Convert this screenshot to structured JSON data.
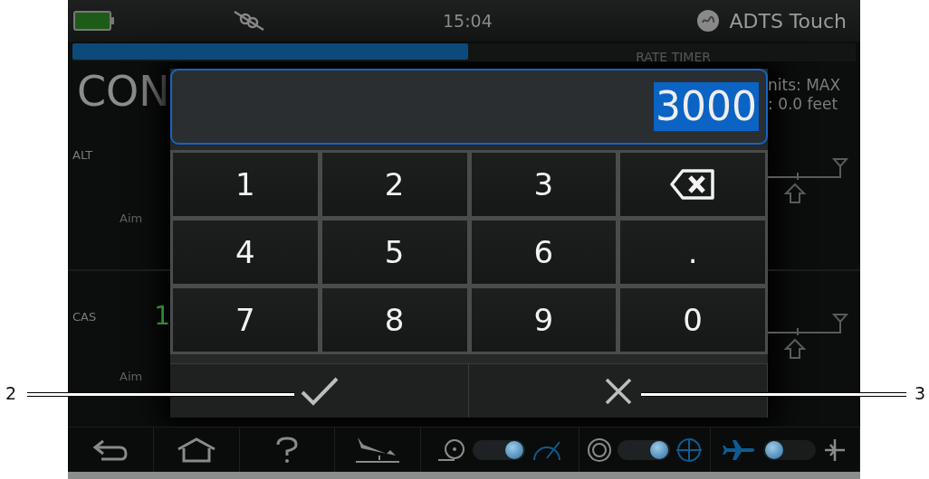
{
  "status_bar": {
    "time": "15:04",
    "device_name": "ADTS Touch"
  },
  "rate_bar": {
    "label": "RATE TIMER",
    "level": 0.505
  },
  "background": {
    "title": "CON",
    "limits": [
      "nits: MAX",
      ": 0.0 feet"
    ],
    "rows": [
      {
        "label": "ALT",
        "aim_label": "Aim"
      },
      {
        "label": "CAS",
        "value": "1",
        "aim_label": "Aim"
      }
    ]
  },
  "keypad": {
    "value": "3000",
    "value_selected": true,
    "keys": [
      {
        "kind": "digit",
        "label": "1"
      },
      {
        "kind": "digit",
        "label": "2"
      },
      {
        "kind": "digit",
        "label": "3"
      },
      {
        "kind": "backspace"
      },
      {
        "kind": "digit",
        "label": "4"
      },
      {
        "kind": "digit",
        "label": "5"
      },
      {
        "kind": "digit",
        "label": "6"
      },
      {
        "kind": "digit",
        "label": "."
      },
      {
        "kind": "digit",
        "label": "7"
      },
      {
        "kind": "digit",
        "label": "8"
      },
      {
        "kind": "digit",
        "label": "9"
      },
      {
        "kind": "digit",
        "label": "0"
      }
    ],
    "actions": [
      {
        "kind": "confirm"
      },
      {
        "kind": "cancel"
      }
    ]
  },
  "toolbar": {
    "toggles": [
      {
        "on": true
      },
      {
        "on": true
      },
      {
        "on": false
      }
    ]
  },
  "callouts": [
    {
      "label": "2"
    },
    {
      "label": "3"
    }
  ]
}
